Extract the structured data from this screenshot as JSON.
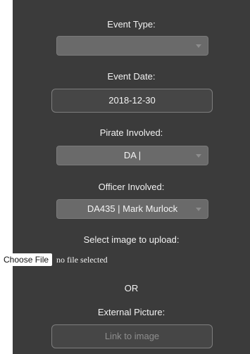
{
  "form": {
    "event_type": {
      "label": "Event Type:",
      "selected": ""
    },
    "event_date": {
      "label": "Event Date:",
      "value": "2018-12-30"
    },
    "pirate_involved": {
      "label": "Pirate Involved:",
      "selected": "DA |"
    },
    "officer_involved": {
      "label": "Officer Involved:",
      "selected": "DA435 | Mark Murlock"
    },
    "upload": {
      "label": "Select image to upload:",
      "button_label": "Choose File",
      "status": "no file selected"
    },
    "or_text": "OR",
    "external_picture": {
      "label": "External Picture:",
      "placeholder": "Link to image"
    }
  },
  "colors": {
    "panel_background": "#3b3b3b",
    "select_background": "#6a6a6a",
    "input_background": "#464646"
  }
}
